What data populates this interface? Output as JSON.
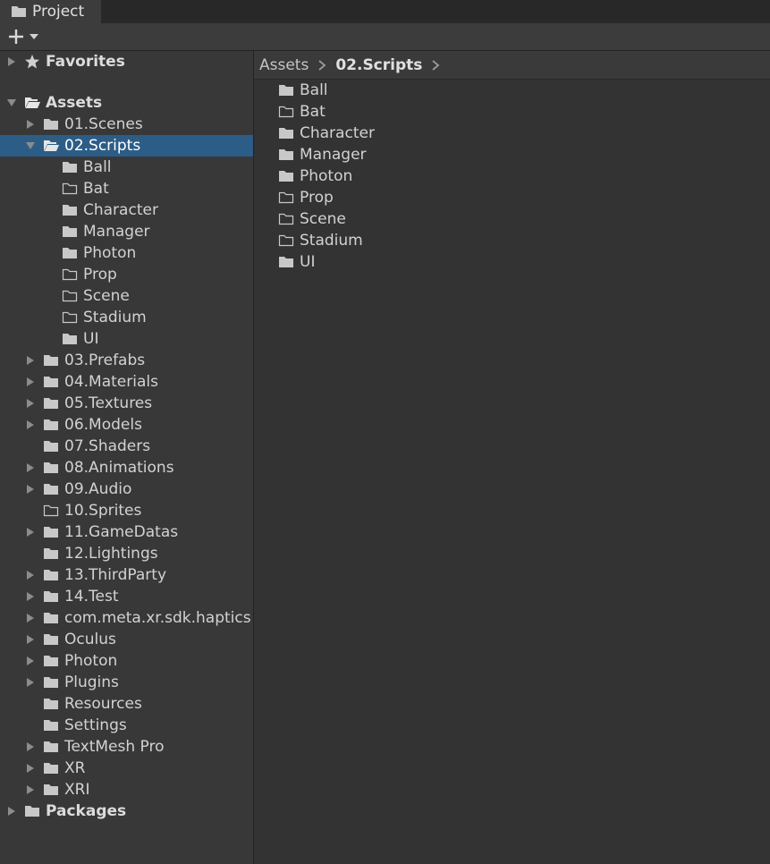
{
  "window": {
    "tab_title": "Project",
    "tab_icon": "folder-icon"
  },
  "toolbar": {
    "add_icon": "plus-icon",
    "dropdown_icon": "chevron-down-icon"
  },
  "tree": {
    "favorites": {
      "label": "Favorites",
      "icon": "star-icon",
      "expanded": false
    },
    "assets": {
      "label": "Assets",
      "expanded": true
    },
    "packages": {
      "label": "Packages",
      "expanded": false
    },
    "asset_children": [
      {
        "label": "01.Scenes",
        "has_arrow": true,
        "filled": true,
        "expanded": false
      },
      {
        "label": "02.Scripts",
        "has_arrow": true,
        "filled": true,
        "expanded": true,
        "selected": true,
        "children": [
          {
            "label": "Ball",
            "filled": true
          },
          {
            "label": "Bat",
            "filled": false
          },
          {
            "label": "Character",
            "filled": true
          },
          {
            "label": "Manager",
            "filled": true
          },
          {
            "label": "Photon",
            "filled": true
          },
          {
            "label": "Prop",
            "filled": false
          },
          {
            "label": "Scene",
            "filled": false
          },
          {
            "label": "Stadium",
            "filled": false
          },
          {
            "label": "UI",
            "filled": true
          }
        ]
      },
      {
        "label": "03.Prefabs",
        "has_arrow": true,
        "filled": true
      },
      {
        "label": "04.Materials",
        "has_arrow": true,
        "filled": true
      },
      {
        "label": "05.Textures",
        "has_arrow": true,
        "filled": true
      },
      {
        "label": "06.Models",
        "has_arrow": true,
        "filled": true
      },
      {
        "label": "07.Shaders",
        "has_arrow": false,
        "filled": true
      },
      {
        "label": "08.Animations",
        "has_arrow": true,
        "filled": true
      },
      {
        "label": "09.Audio",
        "has_arrow": true,
        "filled": true
      },
      {
        "label": "10.Sprites",
        "has_arrow": false,
        "filled": false
      },
      {
        "label": "11.GameDatas",
        "has_arrow": true,
        "filled": true
      },
      {
        "label": "12.Lightings",
        "has_arrow": false,
        "filled": true
      },
      {
        "label": "13.ThirdParty",
        "has_arrow": true,
        "filled": true
      },
      {
        "label": "14.Test",
        "has_arrow": true,
        "filled": true
      },
      {
        "label": "com.meta.xr.sdk.haptics",
        "has_arrow": true,
        "filled": true
      },
      {
        "label": "Oculus",
        "has_arrow": true,
        "filled": true
      },
      {
        "label": "Photon",
        "has_arrow": true,
        "filled": true
      },
      {
        "label": "Plugins",
        "has_arrow": true,
        "filled": true
      },
      {
        "label": "Resources",
        "has_arrow": false,
        "filled": true
      },
      {
        "label": "Settings",
        "has_arrow": false,
        "filled": true
      },
      {
        "label": "TextMesh Pro",
        "has_arrow": true,
        "filled": true
      },
      {
        "label": "XR",
        "has_arrow": true,
        "filled": true
      },
      {
        "label": "XRI",
        "has_arrow": true,
        "filled": true
      }
    ]
  },
  "breadcrumb": {
    "items": [
      "Assets",
      "02.Scripts"
    ],
    "separator_icon": "chevron-right-icon"
  },
  "content": {
    "items": [
      {
        "label": "Ball",
        "filled": true
      },
      {
        "label": "Bat",
        "filled": false
      },
      {
        "label": "Character",
        "filled": true
      },
      {
        "label": "Manager",
        "filled": true
      },
      {
        "label": "Photon",
        "filled": true
      },
      {
        "label": "Prop",
        "filled": false
      },
      {
        "label": "Scene",
        "filled": false
      },
      {
        "label": "Stadium",
        "filled": false
      },
      {
        "label": "UI",
        "filled": true
      }
    ]
  },
  "colors": {
    "selection": "#2c5d87",
    "background": "#383838",
    "content_background": "#333333"
  }
}
